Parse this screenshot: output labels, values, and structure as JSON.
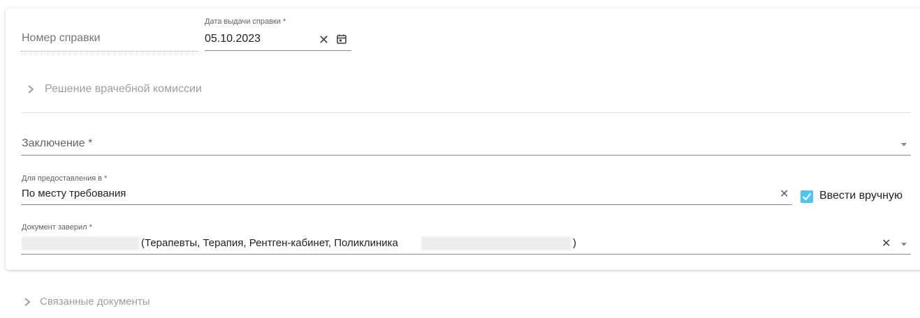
{
  "certificate_number": {
    "label": "Номер справки"
  },
  "issue_date": {
    "label": "Дата выдачи справки *",
    "value": "05.10.2023"
  },
  "commission_section": {
    "label": "Решение врачебной комиссии"
  },
  "conclusion": {
    "label": "Заключение *"
  },
  "provided_to": {
    "label": "Для предоставления в *",
    "value": "По месту требования",
    "manual_entry_label": "Ввести вручную",
    "manual_entry_checked": true
  },
  "certified_by": {
    "label": "Документ заверил *",
    "value_visible": "(Терапевты, Терапия, Рентген-кабинет, Поликлиника",
    "value_tail": ")"
  },
  "related_docs": {
    "label": "Связанные документы"
  },
  "colors": {
    "accent": "#4fc3f7",
    "muted_text": "#9e9e9e"
  }
}
